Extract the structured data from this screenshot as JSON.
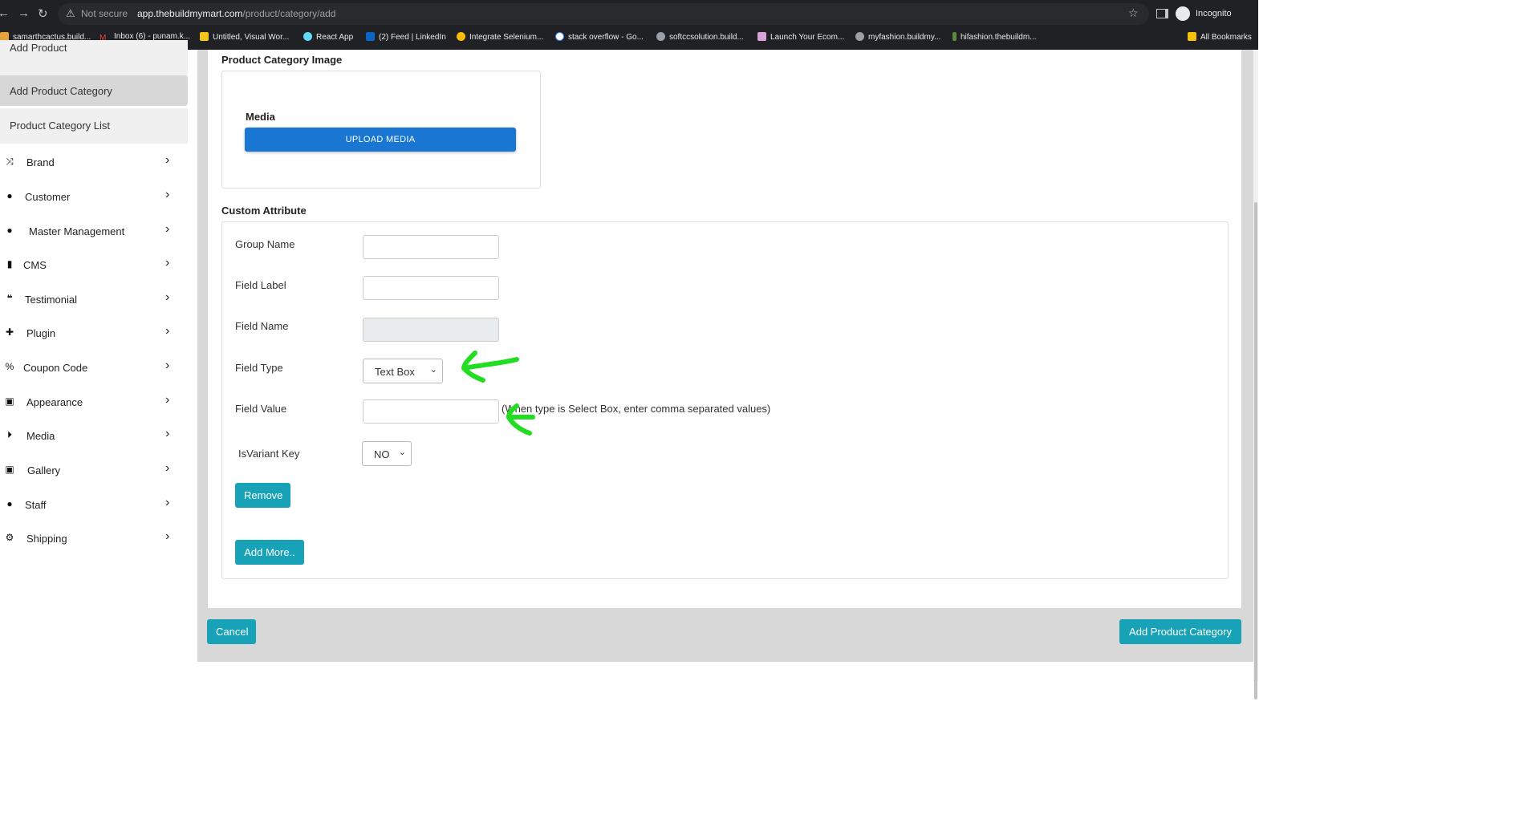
{
  "browser": {
    "security_label": "Not secure",
    "url_host": "app.thebuildmymart.com",
    "url_path": "/product/category/add",
    "profile_label": "Incognito",
    "bookmarks": [
      "samarthcactus.build...",
      "Inbox (6) - punam.k...",
      "Untitled, Visual Wor...",
      "React App",
      "(2) Feed | LinkedIn",
      "Integrate Selenium...",
      "stack overflow - Go...",
      "softccsolution.build...",
      "Launch Your Ecom...",
      "myfashion.buildmy...",
      "hifashion.thebuildm...",
      "All Bookmarks"
    ]
  },
  "sidebar": {
    "submenu": [
      "Add Product",
      "Add Product Category",
      "Product Category List"
    ],
    "menu": [
      {
        "label": "Brand",
        "icon": "shuffle-icon"
      },
      {
        "label": "Customer",
        "icon": "user-icon"
      },
      {
        "label": "Master Management",
        "icon": "user-gear-icon"
      },
      {
        "label": "CMS",
        "icon": "file-icon"
      },
      {
        "label": "Testimonial",
        "icon": "quote-icon"
      },
      {
        "label": "Plugin",
        "icon": "puzzle-icon"
      },
      {
        "label": "Coupon Code",
        "icon": "percent-icon"
      },
      {
        "label": "Appearance",
        "icon": "image-icon"
      },
      {
        "label": "Media",
        "icon": "play-circle-icon"
      },
      {
        "label": "Gallery",
        "icon": "images-icon"
      },
      {
        "label": "Staff",
        "icon": "user-icon"
      },
      {
        "label": "Shipping",
        "icon": "gear-icon"
      }
    ]
  },
  "form": {
    "image_section_title": "Product Category Image",
    "media_label": "Media",
    "upload_button": "UPLOAD MEDIA",
    "custom_attribute_title": "Custom Attribute",
    "group_name_label": "Group Name",
    "field_label_label": "Field Label",
    "field_name_label": "Field Name",
    "field_type_label": "Field Type",
    "field_type_value": "Text Box",
    "field_value_label": "Field Value",
    "field_value_hint": "(When type is Select Box, enter comma separated values)",
    "isvariant_label": "IsVariant Key",
    "isvariant_value": "NO",
    "remove_button": "Remove",
    "add_more_button": "Add More.."
  },
  "footer": {
    "cancel_button": "Cancel",
    "submit_button": "Add Product Category"
  },
  "colors": {
    "primary_button": "#1976d2",
    "teal_button": "#17a2b8",
    "annotation_arrow": "#22dd22"
  }
}
